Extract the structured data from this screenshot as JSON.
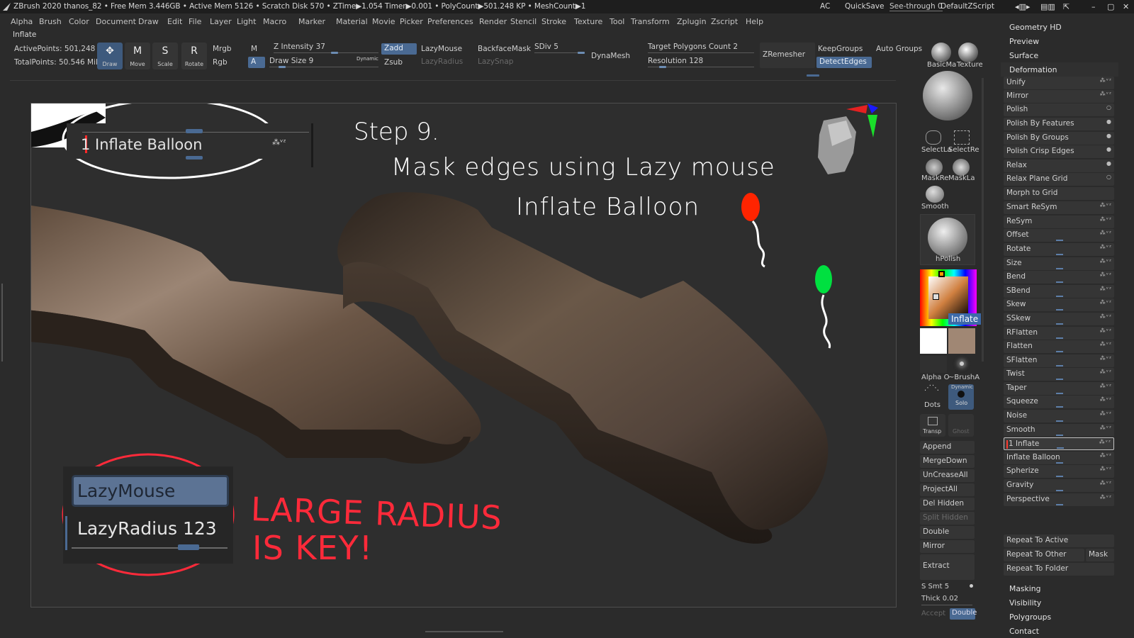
{
  "status_bar": {
    "app_title": "ZBrush 2020",
    "stats": "thanos_82  • Free Mem 3.446GB • Active Mem 5126 • Scratch Disk 570 • ZTime▶1.054 Timer▶0.001 • PolyCount▶501.248 KP • MeshCount▶1",
    "ac": "AC",
    "quicksave": "QuickSave",
    "see_through": "See-through  0",
    "script": "DefaultZScript"
  },
  "menu_bar": [
    "Alpha",
    "Brush",
    "Color",
    "Document",
    "Draw",
    "Edit",
    "File",
    "Layer",
    "Light",
    "Macro",
    "Marker",
    "Material",
    "Movie",
    "Picker",
    "Preferences",
    "Render",
    "Stencil",
    "Stroke",
    "Texture",
    "Tool",
    "Transform",
    "Zplugin",
    "Zscript",
    "Help"
  ],
  "brush_name": "Inflate",
  "shelf": {
    "active_points": "ActivePoints: 501,248",
    "total_points": "TotalPoints: 50.546 Mil",
    "tools": [
      {
        "label": "Draw",
        "icon": "draw-icon"
      },
      {
        "label": "Move",
        "icon": "move-icon"
      },
      {
        "label": "Scale",
        "icon": "scale-icon"
      },
      {
        "label": "Rotate",
        "icon": "rotate-icon"
      }
    ],
    "mrgb": "Mrgb",
    "rgb": "Rgb",
    "m": "M",
    "a": "A",
    "z_intensity": "Z Intensity 37",
    "draw_size": "Draw Size 9",
    "dynamic": "Dynamic",
    "zadd": "Zadd",
    "zsub": "Zsub",
    "lazymouse": "LazyMouse",
    "lazyradius": "LazyRadius",
    "backfacemask": "BackfaceMask",
    "lazysnap": "LazySnap",
    "sdiv": "SDiv 5",
    "dynamesh": "DynaMesh",
    "target_polygons": "Target Polygons Count 2",
    "resolution": "Resolution 128",
    "zremesher": "ZRemesher",
    "keepgroups": "KeepGroups",
    "auto_groups": "Auto Groups",
    "detect_edges": "DetectEdges",
    "basic_material": "BasicMa",
    "texture": "Texture"
  },
  "annotations": {
    "zoom_slider": "1 Inflate Balloon",
    "step_title": "Step 9.",
    "step_line1": "Mask edges using Lazy mouse",
    "step_line2": "Inflate Balloon",
    "lazymouse_zoom": "LazyMouse",
    "lazyradius_zoom": "LazyRadius 123",
    "note_line1": "LARGE RADIUS",
    "note_line2": "IS KEY!"
  },
  "mid_column": {
    "select_lasso": "SelectLa",
    "select_rect": "SelectRe",
    "mask_rect": "MaskRe",
    "mask_lasso": "MaskLa",
    "smooth": "Smooth",
    "hpolish": "hPolish",
    "inflate_badge": "Inflate",
    "alpha_off": "Alpha O",
    "brush_alpha": "~BrushA",
    "dots": "Dots",
    "dynamic": "Dynamic",
    "solo": "Solo",
    "transp": "Transp",
    "ghost": "Ghost",
    "buttons": [
      "Append",
      "MergeDown",
      "UnCreaseAll",
      "ProjectAll",
      "Del Hidden",
      "Split Hidden",
      "Double",
      "Mirror",
      "Extract"
    ],
    "s_smt": "S Smt 5",
    "thick": "Thick 0.02",
    "accept": "Accept",
    "double": "Double",
    "colors": {
      "main": "#ffffff",
      "secondary": "#a08774",
      "inflate_badge": "#3d6aa8"
    }
  },
  "right_panel": {
    "top_items": [
      "Geometry HD",
      "Preview",
      "Surface"
    ],
    "deformation_title": "Deformation",
    "deformation_items": [
      "Unify",
      "Mirror",
      "Polish",
      "Polish By Features",
      "Polish By Groups",
      "Polish Crisp Edges",
      "Relax",
      "Relax Plane Grid",
      "Morph to Grid",
      "Smart ReSym",
      "ReSym",
      "Offset",
      "Rotate",
      "Size",
      "Bend",
      "SBend",
      "Skew",
      "SSkew",
      "RFlatten",
      "Flatten",
      "SFlatten",
      "Twist",
      "Taper",
      "Squeeze",
      "Noise",
      "Smooth",
      "1 Inflate",
      "Inflate Balloon",
      "Spherize",
      "Gravity",
      "Perspective"
    ],
    "repeat_to_active": "Repeat To Active",
    "repeat_to_other": "Repeat To Other",
    "mask": "Mask",
    "repeat_to_folder": "Repeat To Folder",
    "bottom_items": [
      "Masking",
      "Visibility",
      "Polygroups",
      "Contact"
    ]
  },
  "colors": {
    "accent": "#4a6a93",
    "annotation_red": "#ff2a3a",
    "balloon_red": "#ff2400",
    "balloon_green": "#00e040",
    "model": "#7a6453"
  }
}
